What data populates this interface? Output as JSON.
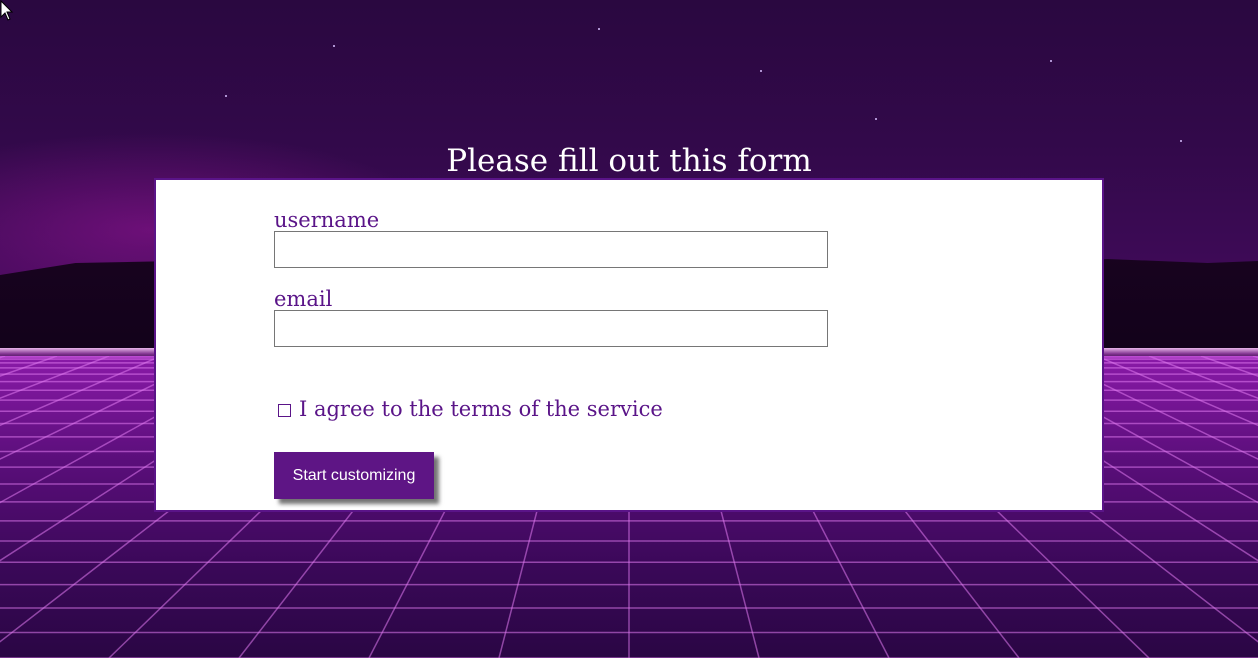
{
  "form": {
    "title": "Please fill out this form",
    "username_label": "username",
    "username_value": "",
    "email_label": "email",
    "email_value": "",
    "agree_label": "I agree to the terms of the service",
    "agree_checked": false,
    "submit_label": "Start customizing"
  },
  "colors": {
    "accent": "#5e1585",
    "label_text": "#5a1488",
    "card_background": "#ffffff",
    "title_text": "#ffffff"
  },
  "background": {
    "theme": "synthwave neon grid"
  },
  "icons": {
    "cursor": "mouse-pointer-icon"
  }
}
